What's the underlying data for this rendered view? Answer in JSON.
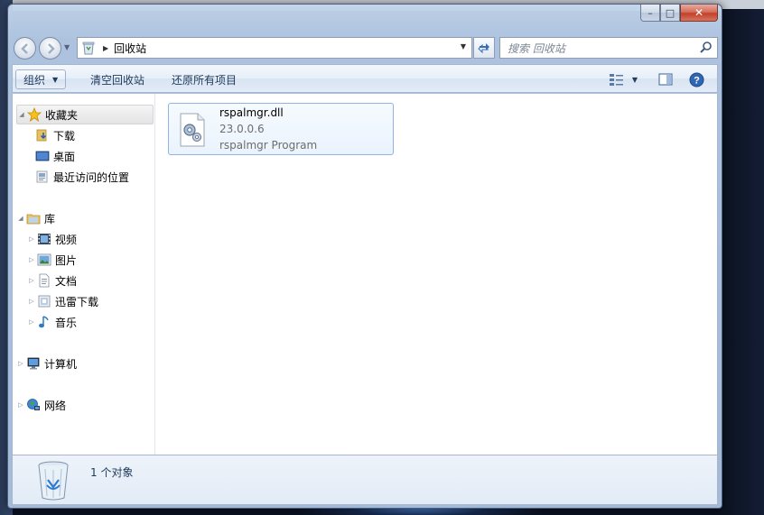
{
  "window": {
    "minimize_glyph": "–",
    "maximize_glyph": "□",
    "close_glyph": "✕"
  },
  "address": {
    "location": "回收站",
    "search_placeholder": "搜索 回收站"
  },
  "toolbar": {
    "organize_label": "组织",
    "empty_bin_label": "清空回收站",
    "restore_all_label": "还原所有项目"
  },
  "nav_pane": {
    "favorites": {
      "label": "收藏夹",
      "items": [
        "下载",
        "桌面",
        "最近访问的位置"
      ]
    },
    "libraries": {
      "label": "库",
      "items": [
        "视频",
        "图片",
        "文档",
        "迅雷下载",
        "音乐"
      ]
    },
    "computer": {
      "label": "计算机"
    },
    "network": {
      "label": "网络"
    }
  },
  "files": [
    {
      "name": "rspalmgr.dll",
      "version": "23.0.0.6",
      "description": "rspalmgr Program",
      "icon": "dll-gear-icon"
    }
  ],
  "details": {
    "count_text": "1 个对象"
  },
  "colors": {
    "accent": "#3a6cb4",
    "selection_border": "#8fb4dd",
    "text_primary": "#1e395b"
  }
}
